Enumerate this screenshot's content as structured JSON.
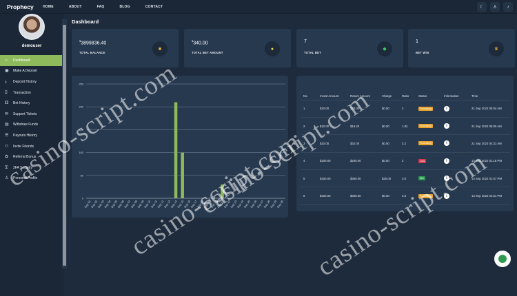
{
  "app": {
    "name": "Prophecy"
  },
  "nav": [
    "HOME",
    "ABOUT",
    "FAQ",
    "BLOG",
    "CONTACT"
  ],
  "top_icons": [
    "moon-icon",
    "user-icon",
    "bell-icon"
  ],
  "user": {
    "name": "demouser"
  },
  "sidebar": {
    "items": [
      {
        "label": "Dashboard",
        "icon": "home-icon",
        "active": true
      },
      {
        "label": "Make A Deposit",
        "icon": "wallet-icon"
      },
      {
        "label": "Deposit History",
        "icon": "download-icon"
      },
      {
        "label": "Transaction",
        "icon": "bank-icon"
      },
      {
        "label": "Bet History",
        "icon": "dice-icon"
      },
      {
        "label": "Support Tickets",
        "icon": "ticket-icon"
      },
      {
        "label": "Withdraw Funds",
        "icon": "wallet-out-icon"
      },
      {
        "label": "Payouts History",
        "icon": "list-icon"
      },
      {
        "label": "Invite Friends",
        "icon": "users-icon"
      },
      {
        "label": "Referral Bonus",
        "icon": "gift-icon"
      },
      {
        "label": "2FA Security",
        "icon": "lock-icon"
      },
      {
        "label": "Personal Profile",
        "icon": "user-icon"
      }
    ]
  },
  "page": {
    "title": "Dashboard"
  },
  "cards": [
    {
      "currency": "$",
      "value": "3899836.40",
      "label": "TOTAL BALANCE",
      "icon": "wallet-icon",
      "icon_color": "#f2b731"
    },
    {
      "currency": "$",
      "value": "340.00",
      "label": "TOTAL BET AMOUNT",
      "icon": "coin-icon",
      "icon_color": "#e8e04a"
    },
    {
      "currency": "",
      "value": "7",
      "label": "TOTAL BET",
      "icon": "cube-icon",
      "icon_color": "#3ccf62"
    },
    {
      "currency": "",
      "value": "1",
      "label": "BET WIN",
      "icon": "trophy-icon",
      "icon_color": "#f2b731"
    }
  ],
  "chart_data": {
    "type": "bar",
    "categories": [
      "Day 01",
      "Day 02",
      "Day 03",
      "Day 04",
      "Day 05",
      "Day 06",
      "Day 07",
      "Day 08",
      "Day 09",
      "Day 10",
      "Day 11",
      "Day 12",
      "Day 13",
      "Day 14",
      "Day 15",
      "Day 16",
      "Day 17",
      "Day 18",
      "Day 19",
      "Day 20",
      "Day 21",
      "Day 22",
      "Day 23",
      "Day 24",
      "Day 25",
      "Day 26",
      "Day 27",
      "Day 28",
      "Day 29",
      "Day 30"
    ],
    "values": [
      0,
      0,
      0,
      0,
      0,
      0,
      0,
      0,
      0,
      0,
      0,
      0,
      0,
      210,
      100,
      0,
      0,
      0,
      0,
      0,
      30,
      0,
      0,
      0,
      0,
      0,
      0,
      0,
      0,
      0
    ],
    "yticks": [
      0,
      50,
      100,
      150,
      200,
      250
    ],
    "ylim": [
      0,
      250
    ],
    "bar_color": "#8fba5c",
    "grid": true
  },
  "table": {
    "headers": [
      "No.",
      "Invest Amount",
      "Return Amount",
      "Charge",
      "Ratio",
      "Status",
      "Information",
      "Time"
    ],
    "rows": [
      {
        "no": "1",
        "invest": "$10.00",
        "ret": "$20.00",
        "charge": "$0.00",
        "ratio": "2",
        "status": "Processing",
        "status_type": "proc",
        "time": "21 Sep 2022 05:04 AM"
      },
      {
        "no": "2",
        "invest": "$10.00",
        "ret": "$19.20",
        "charge": "$0.00",
        "ratio": "1.92",
        "status": "Processing",
        "status_type": "proc",
        "time": "21 Sep 2022 05:00 AM"
      },
      {
        "no": "3",
        "invest": "$10.00",
        "ret": "$32.00",
        "charge": "$0.00",
        "ratio": "3.2",
        "status": "Processing",
        "status_type": "proc",
        "time": "21 Sep 2022 04:31 AM"
      },
      {
        "no": "4",
        "invest": "$100.00",
        "ret": "$200.00",
        "charge": "$0.00",
        "ratio": "2",
        "status": "Loss",
        "status_type": "loss",
        "time": "14 Sep 2022 01:18 PM"
      },
      {
        "no": "5",
        "invest": "$100.00",
        "ret": "$360.00",
        "charge": "$25.00",
        "ratio": "3.6",
        "status": "Win",
        "status_type": "win",
        "time": "13 Sep 2022 01:57 PM"
      },
      {
        "no": "6",
        "invest": "$100.00",
        "ret": "$360.00",
        "charge": "$0.00",
        "ratio": "3.6",
        "status": "Processing",
        "status_type": "proc",
        "time": "13 Sep 2022 01:51 PM"
      }
    ]
  },
  "watermark": "casino-script.com"
}
